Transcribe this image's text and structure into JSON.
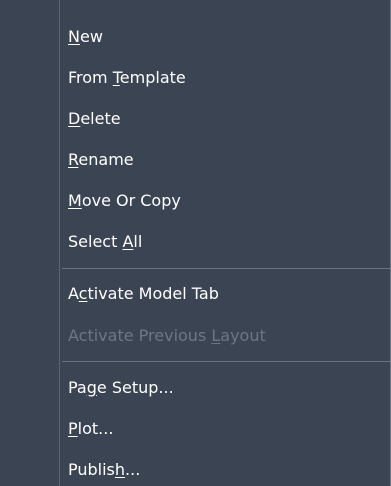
{
  "menu": {
    "items": [
      {
        "pre": "",
        "u": "N",
        "post": "ew"
      },
      {
        "pre": "From ",
        "u": "T",
        "post": "emplate"
      },
      {
        "pre": "",
        "u": "D",
        "post": "elete"
      },
      {
        "pre": "",
        "u": "R",
        "post": "ename"
      },
      {
        "pre": "",
        "u": "M",
        "post": "ove Or Copy"
      },
      {
        "pre": "Select ",
        "u": "A",
        "post": "ll"
      },
      {
        "pre": "A",
        "u": "c",
        "post": "tivate Model Tab"
      },
      {
        "pre": "Activate Previous ",
        "u": "L",
        "post": "ayout"
      },
      {
        "pre": "Pa",
        "u": "g",
        "post": "e Setup..."
      },
      {
        "pre": "",
        "u": "P",
        "post": "lot..."
      },
      {
        "pre": "Publis",
        "u": "h",
        "post": "..."
      }
    ]
  }
}
